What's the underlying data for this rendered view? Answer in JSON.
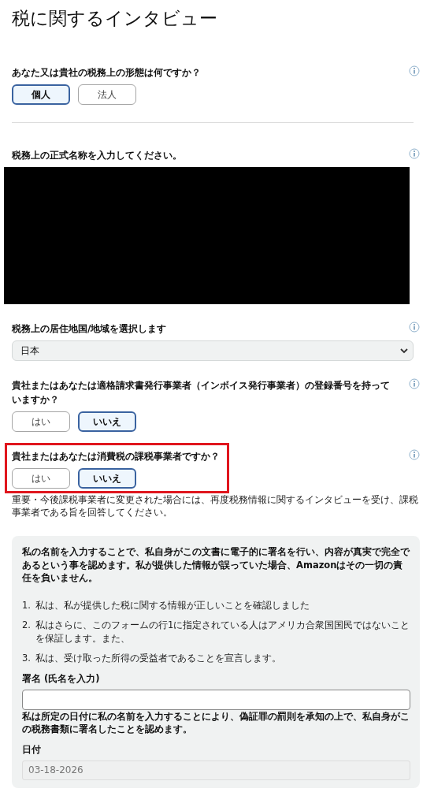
{
  "title": "税に関するインタビュー",
  "questions": [
    {
      "kind": "choice",
      "label": "あなた又は貴社の税務上の形態は何ですか？",
      "highlighted": false,
      "options": [
        {
          "label": "個人",
          "selected": true
        },
        {
          "label": "法人",
          "selected": false
        }
      ]
    },
    {
      "kind": "redacted",
      "label": "税務上の正式名称を入力してください。",
      "highlighted": false
    },
    {
      "kind": "select",
      "label": "税務上の居住地国/地域を選択します",
      "highlighted": false,
      "value": "日本"
    },
    {
      "kind": "choice",
      "label": "貴社またはあなたは適格請求書発行事業者（インボイス発行事業者）の登録番号を持っていますか？",
      "highlighted": false,
      "options": [
        {
          "label": "はい",
          "selected": false
        },
        {
          "label": "いいえ",
          "selected": true
        }
      ]
    },
    {
      "kind": "choice",
      "label": "貴社またはあなたは消費税の課税事業者ですか？",
      "highlighted": true,
      "options": [
        {
          "label": "はい",
          "selected": false
        },
        {
          "label": "いいえ",
          "selected": true
        }
      ],
      "note": "重要・今後課税事業者に変更された場合には、再度税務情報に関するインタビューを受け、課税事業者である旨を回答してください。"
    }
  ],
  "certification": {
    "statement": "私の名前を入力することで、私自身がこの文書に電子的に署名を行い、内容が真実で完全であるという事を認めます。私が提供した情報が誤っていた場合、Amazonはその一切の責任を負いません。",
    "items": [
      {
        "number": "1.",
        "text": "私は、私が提供した税に関する情報が正しいことを確認しました"
      },
      {
        "number": "2.",
        "text": "私はさらに、このフォームの行1に指定されている人はアメリカ合衆国国民ではないことを保証します。また、"
      },
      {
        "number": "3.",
        "text": "私は、受け取った所得の受益者であることを宣言します。"
      }
    ],
    "signature_label": "署名 (氏名を入力)",
    "signature_note": "私は所定の日付に私の名前を入力することにより、偽証罪の罰則を承知の上で、私自身がこの税務書類に署名したことを認めます。",
    "date_label": "日付",
    "date_value": "03-18-2026"
  }
}
